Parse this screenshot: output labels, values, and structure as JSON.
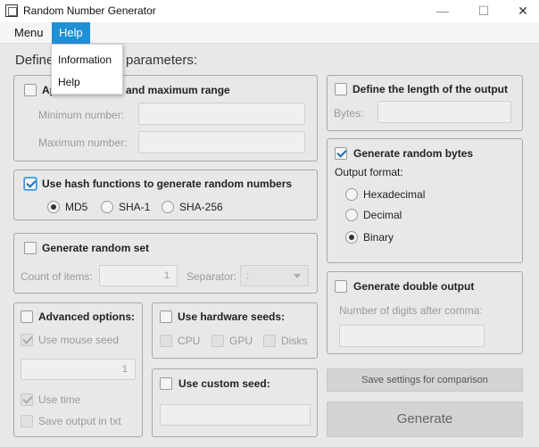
{
  "window": {
    "title": "Random Number Generator",
    "icons": [
      "app-icon",
      "minimize-icon",
      "maximize-icon",
      "close-icon"
    ]
  },
  "menubar": {
    "menu": "Menu",
    "help": "Help"
  },
  "help_menu": {
    "items": [
      "Information",
      "Help"
    ]
  },
  "main": {
    "section_title_left": "Define",
    "section_title_right": "parameters:"
  },
  "range": {
    "checkbox_label_visible": "Ap",
    "checkbox_label_suffix": "and maximum range",
    "min_label": "Minimum number:",
    "max_label": "Maximum number:",
    "min_value": "",
    "max_value": ""
  },
  "length": {
    "checkbox_label": "Define the length of the output",
    "bytes_label": "Bytes:",
    "bytes_value": ""
  },
  "hash": {
    "checkbox_label": "Use hash functions to generate random numbers",
    "options": [
      "MD5",
      "SHA-1",
      "SHA-256"
    ],
    "selected": "MD5"
  },
  "bytes_gen": {
    "checkbox_label": "Generate random bytes",
    "format_label": "Output format:",
    "options": [
      "Hexadecimal",
      "Decimal",
      "Binary"
    ],
    "selected": "Binary"
  },
  "random_set": {
    "checkbox_label": "Generate random set",
    "count_label": "Count of items:",
    "count_value": "1",
    "separator_label": "Separator:",
    "separator_value": ";"
  },
  "double": {
    "checkbox_label": "Generate double output",
    "digits_label": "Number of digits after comma:",
    "digits_value": ""
  },
  "advanced": {
    "checkbox_label": "Advanced options:",
    "mouse_seed": "Use mouse seed",
    "seed_value": "1",
    "use_time": "Use time",
    "save_txt": "Save output in txt"
  },
  "hardware": {
    "checkbox_label": "Use hardware seeds:",
    "options": [
      "CPU",
      "GPU",
      "Disks"
    ]
  },
  "custom_seed": {
    "checkbox_label": "Use custom seed:",
    "value": ""
  },
  "actions": {
    "save_settings": "Save settings for comparison",
    "generate": "Generate"
  },
  "colors": {
    "menu_active": "#1f8fd6",
    "panel_bg": "#e8e8e8",
    "check_blue": "#1a6fb3"
  }
}
